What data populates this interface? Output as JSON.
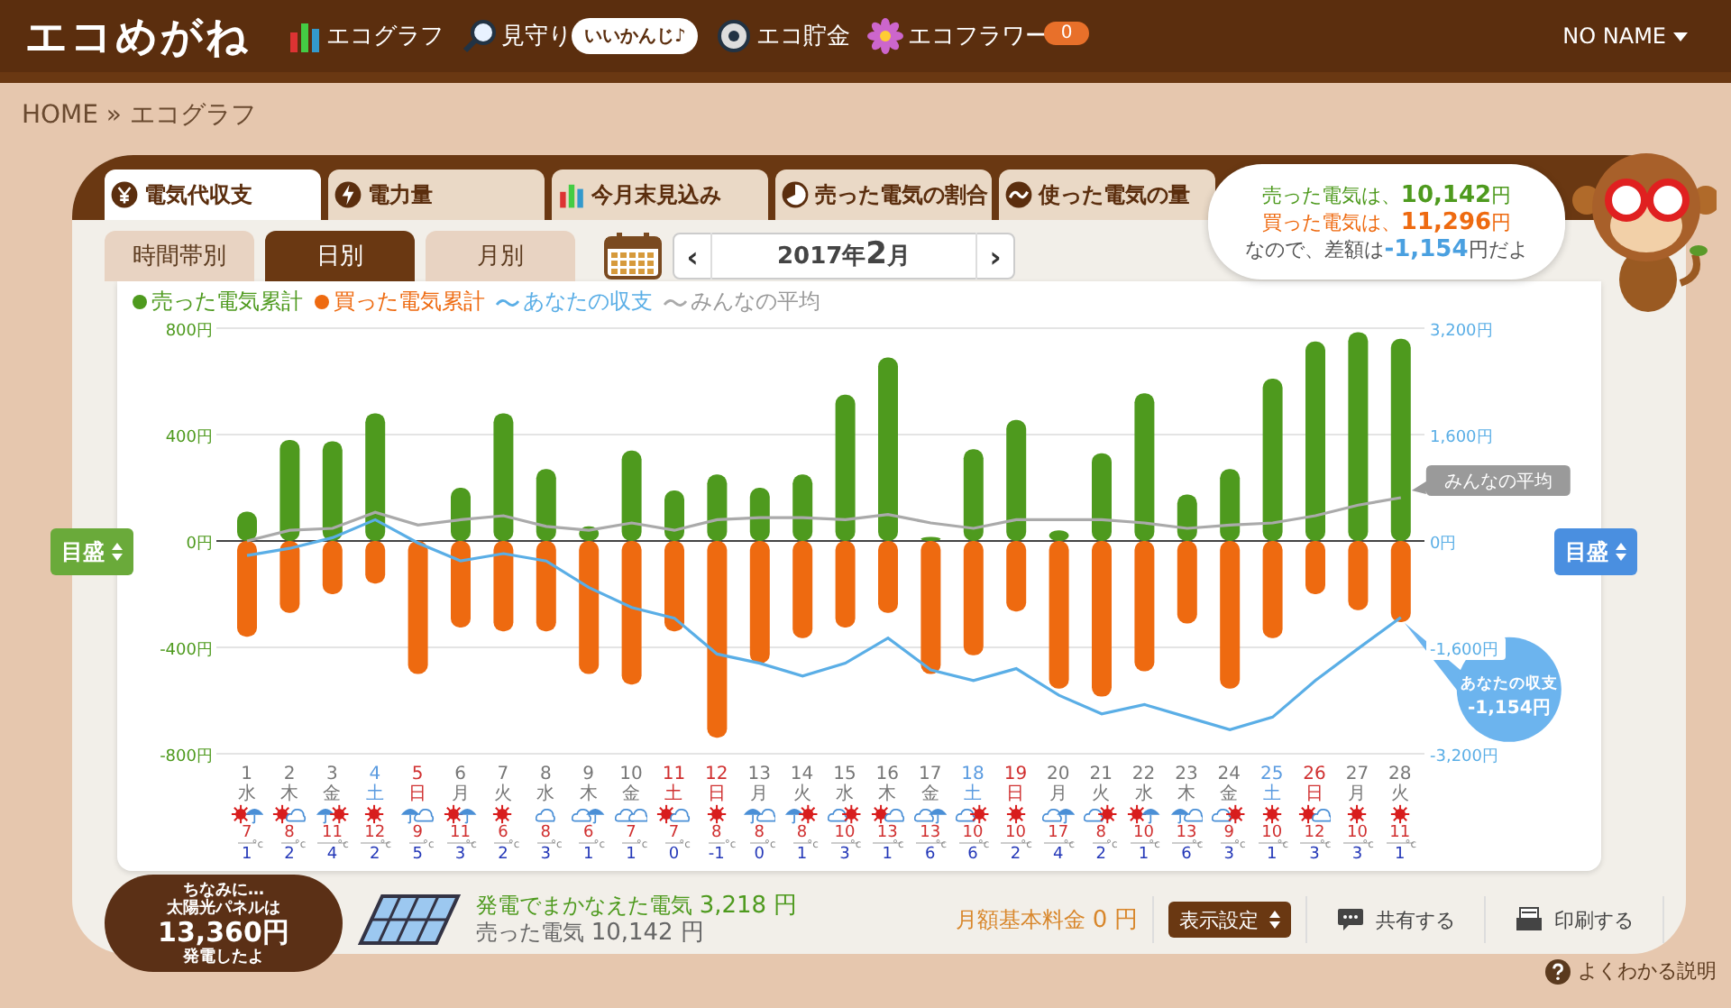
{
  "header": {
    "logo": "エコめがね",
    "nav": [
      {
        "label": "エコグラフ"
      },
      {
        "label": "見守り",
        "bubble": "いいかんじ♪"
      },
      {
        "label": "エコ貯金"
      },
      {
        "label": "エコフラワー",
        "badge": "0"
      }
    ],
    "user": "NO NAME"
  },
  "breadcrumb": "HOME » エコグラフ",
  "tabs": [
    {
      "label": "電気代収支",
      "selected": true
    },
    {
      "label": "電力量",
      "selected": false
    },
    {
      "label": "今月末見込み",
      "selected": false
    },
    {
      "label": "売った電気の割合",
      "selected": false
    },
    {
      "label": "使った電気の量",
      "selected": false
    }
  ],
  "subtabs": [
    {
      "label": "時間帯別",
      "selected": false
    },
    {
      "label": "日別",
      "selected": true
    },
    {
      "label": "月別",
      "selected": false
    }
  ],
  "month_nav": {
    "prev": "‹",
    "month": "2017年**2**月",
    "next": "›"
  },
  "summary": [
    {
      "kind": "sold",
      "text": "売った電気は、**10,142**円"
    },
    {
      "kind": "bought",
      "text": "買った電気は、**11,296**円"
    },
    {
      "kind": "diff",
      "text": "なので、差額は**-1,154**円だよ"
    }
  ],
  "scale_buttons": [
    {
      "label": "目盛"
    },
    {
      "label": "目盛"
    }
  ],
  "chart_data": {
    "type": "bar",
    "stacked": true,
    "categories": [
      "1",
      "2",
      "3",
      "4",
      "5",
      "6",
      "7",
      "8",
      "9",
      "10",
      "11",
      "12",
      "13",
      "14",
      "15",
      "16",
      "17",
      "18",
      "19",
      "20",
      "21",
      "22",
      "23",
      "24",
      "25",
      "26",
      "27",
      "28"
    ],
    "ylim": [
      -800,
      800
    ],
    "yticks": [
      {
        "value": 800,
        "label": "800円"
      },
      {
        "value": 400,
        "label": "400円"
      },
      {
        "value": 0,
        "label": "0円"
      },
      {
        "value": -400,
        "label": "-400円"
      },
      {
        "value": -800,
        "label": "-800円"
      }
    ],
    "y2lim": [
      -3200,
      3200
    ],
    "y2ticks": [
      {
        "value": 3200,
        "label": "3,200円"
      },
      {
        "value": 1600,
        "label": "1,600円"
      },
      {
        "value": 0,
        "label": "0円"
      },
      {
        "value": -1600,
        "label": "-1,600円"
      },
      {
        "value": -3200,
        "label": "-3,200円"
      }
    ],
    "series": [
      {
        "name": "売った電気累計",
        "color": "#4e9a1e",
        "values": [
          110,
          380,
          375,
          480,
          0,
          200,
          480,
          270,
          55,
          340,
          190,
          250,
          200,
          250,
          550,
          690,
          15,
          345,
          455,
          40,
          330,
          555,
          175,
          270,
          610,
          750,
          785,
          760
        ]
      },
      {
        "name": "買った電気累計",
        "color": "#ee6a10",
        "values": [
          -360,
          -270,
          -200,
          -160,
          -500,
          -325,
          -340,
          -340,
          -500,
          -540,
          -340,
          -740,
          -460,
          -365,
          -325,
          -270,
          -500,
          -430,
          -265,
          -555,
          -585,
          -490,
          -310,
          -555,
          -365,
          -200,
          -260,
          -305
        ]
      },
      {
        "name": "あなたの収支",
        "type": "line",
        "axis": "y2",
        "color": "#5aaee6",
        "values": [
          -220,
          -110,
          50,
          320,
          -30,
          -300,
          -190,
          -300,
          -700,
          -1000,
          -1160,
          -1700,
          -1840,
          -2030,
          -1840,
          -1460,
          -1940,
          -2100,
          -1920,
          -2320,
          -2600,
          -2460,
          -2650,
          -2840,
          -2650,
          -2100,
          -1620,
          -1150
        ]
      },
      {
        "name": "みんなの平均",
        "type": "line",
        "axis": "y2",
        "color": "#aaaaaa",
        "values": [
          0,
          160,
          190,
          430,
          240,
          320,
          380,
          220,
          160,
          270,
          160,
          320,
          350,
          350,
          320,
          400,
          270,
          190,
          320,
          320,
          320,
          270,
          190,
          240,
          270,
          380,
          540,
          650
        ]
      }
    ],
    "legend": "top",
    "annotations": [
      "みんなの平均",
      "あなたの収支",
      "-1,154円"
    ]
  },
  "days": [
    {
      "weekday": "水",
      "kind": "weekday",
      "weather": {
        "kind": "sun-umbrella"
      },
      "high": "7",
      "low": "1",
      "unit": "°c"
    },
    {
      "weekday": "木",
      "kind": "weekday",
      "weather": {
        "kind": "sun-cloud"
      },
      "high": "8",
      "low": "2",
      "unit": "°c"
    },
    {
      "weekday": "金",
      "kind": "weekday",
      "weather": {
        "kind": "umbrella-sun"
      },
      "high": "11",
      "low": "4",
      "unit": "°c"
    },
    {
      "weekday": "土",
      "kind": "saturday",
      "weather": {
        "kind": "sun"
      },
      "high": "12",
      "low": "2",
      "unit": "°c"
    },
    {
      "weekday": "日",
      "kind": "holiday",
      "weather": {
        "kind": "umbrella-cloud"
      },
      "high": "9",
      "low": "5",
      "unit": "°c"
    },
    {
      "weekday": "月",
      "kind": "weekday",
      "weather": {
        "kind": "sun-umbrella"
      },
      "high": "11",
      "low": "3",
      "unit": "°c"
    },
    {
      "weekday": "火",
      "kind": "weekday",
      "weather": {
        "kind": "sun"
      },
      "high": "6",
      "low": "2",
      "unit": "°c"
    },
    {
      "weekday": "水",
      "kind": "weekday",
      "weather": {
        "kind": "cloud"
      },
      "high": "8",
      "low": "3",
      "unit": "°c"
    },
    {
      "weekday": "木",
      "kind": "weekday",
      "weather": {
        "kind": "cloud-umbrella"
      },
      "high": "6",
      "low": "1",
      "unit": "°c"
    },
    {
      "weekday": "金",
      "kind": "weekday",
      "weather": {
        "kind": "cloud-cloud"
      },
      "high": "7",
      "low": "1",
      "unit": "°c"
    },
    {
      "weekday": "土",
      "kind": "holiday",
      "weather": {
        "kind": "sun-cloud"
      },
      "high": "7",
      "low": "0",
      "unit": "°c"
    },
    {
      "weekday": "日",
      "kind": "holiday",
      "weather": {
        "kind": "sun"
      },
      "high": "8",
      "low": "-1",
      "unit": "°c"
    },
    {
      "weekday": "月",
      "kind": "weekday",
      "weather": {
        "kind": "umbrella-cloud"
      },
      "high": "8",
      "low": "0",
      "unit": "°c"
    },
    {
      "weekday": "火",
      "kind": "weekday",
      "weather": {
        "kind": "umbrella-sun"
      },
      "high": "8",
      "low": "1",
      "unit": "°c"
    },
    {
      "weekday": "水",
      "kind": "weekday",
      "weather": {
        "kind": "cloud-sun"
      },
      "high": "10",
      "low": "3",
      "unit": "°c"
    },
    {
      "weekday": "木",
      "kind": "weekday",
      "weather": {
        "kind": "sun-cloud"
      },
      "high": "13",
      "low": "1",
      "unit": "°c"
    },
    {
      "weekday": "金",
      "kind": "weekday",
      "weather": {
        "kind": "cloud-umbrella"
      },
      "high": "13",
      "low": "6",
      "unit": "°c"
    },
    {
      "weekday": "土",
      "kind": "saturday",
      "weather": {
        "kind": "cloud-sun"
      },
      "high": "10",
      "low": "6",
      "unit": "°c"
    },
    {
      "weekday": "日",
      "kind": "holiday",
      "weather": {
        "kind": "sun"
      },
      "high": "10",
      "low": "2",
      "unit": "°c"
    },
    {
      "weekday": "月",
      "kind": "weekday",
      "weather": {
        "kind": "cloud-umbrella"
      },
      "high": "17",
      "low": "4",
      "unit": "°c"
    },
    {
      "weekday": "火",
      "kind": "weekday",
      "weather": {
        "kind": "cloud-sun"
      },
      "high": "8",
      "low": "2",
      "unit": "°c"
    },
    {
      "weekday": "水",
      "kind": "weekday",
      "weather": {
        "kind": "sun-umbrella"
      },
      "high": "10",
      "low": "1",
      "unit": "°c"
    },
    {
      "weekday": "木",
      "kind": "weekday",
      "weather": {
        "kind": "umbrella-cloud"
      },
      "high": "13",
      "low": "6",
      "unit": "°c"
    },
    {
      "weekday": "金",
      "kind": "weekday",
      "weather": {
        "kind": "cloud-sun"
      },
      "high": "9",
      "low": "3",
      "unit": "°c"
    },
    {
      "weekday": "土",
      "kind": "saturday",
      "weather": {
        "kind": "sun"
      },
      "high": "10",
      "low": "1",
      "unit": "°c"
    },
    {
      "weekday": "日",
      "kind": "holiday",
      "weather": {
        "kind": "sun-cloud"
      },
      "high": "12",
      "low": "3",
      "unit": "°c"
    },
    {
      "weekday": "月",
      "kind": "weekday",
      "weather": {
        "kind": "sun"
      },
      "high": "10",
      "low": "3",
      "unit": "°c"
    },
    {
      "weekday": "火",
      "kind": "weekday",
      "weather": {
        "kind": "sun"
      },
      "high": "11",
      "low": "1",
      "unit": "°c"
    }
  ],
  "solar_bubble": [
    "ちなみに…",
    "太陽光パネルは",
    "13,360円",
    "発電したよ"
  ],
  "totals": [
    {
      "kind": "covered",
      "label": "発電でまかなえた電気",
      "value": "3,218 円"
    },
    {
      "kind": "sold",
      "label": "売った電気",
      "value": "10,142 円"
    }
  ],
  "base_fee": {
    "label": "月額基本料金",
    "value": "0 円"
  },
  "actions": [
    {
      "label": "表示設定",
      "kind": "select"
    },
    {
      "label": "共有する",
      "kind": "share"
    },
    {
      "label": "印刷する",
      "kind": "print"
    }
  ],
  "help": "よくわかる説明"
}
